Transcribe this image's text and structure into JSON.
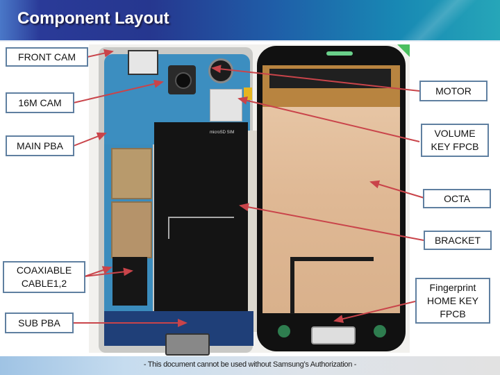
{
  "header": {
    "title": "Component Layout"
  },
  "labels": {
    "front_cam": "FRONT CAM",
    "cam16m": "16M CAM",
    "main_pba": "MAIN PBA",
    "coaxiable_cable": "COAXIABLE\nCABLE1,2",
    "sub_pba": "SUB PBA",
    "motor": "MOTOR",
    "volume_key_fpcb": "VOLUME\nKEY FPCB",
    "octa": "OCTA",
    "bracket": "BRACKET",
    "fingerprint_home_key_fpcb": "Fingerprint\nHOME KEY\nFPCB"
  },
  "photo": {
    "microsd_marking": "microSD SIM"
  },
  "colors": {
    "arrow": "#c9444a",
    "label_border": "#5f7fa0",
    "header_dark": "#26378f",
    "header_light": "#26a6b8"
  },
  "footer": {
    "notice": "- This document cannot be used without Samsung’s Authorization -"
  }
}
